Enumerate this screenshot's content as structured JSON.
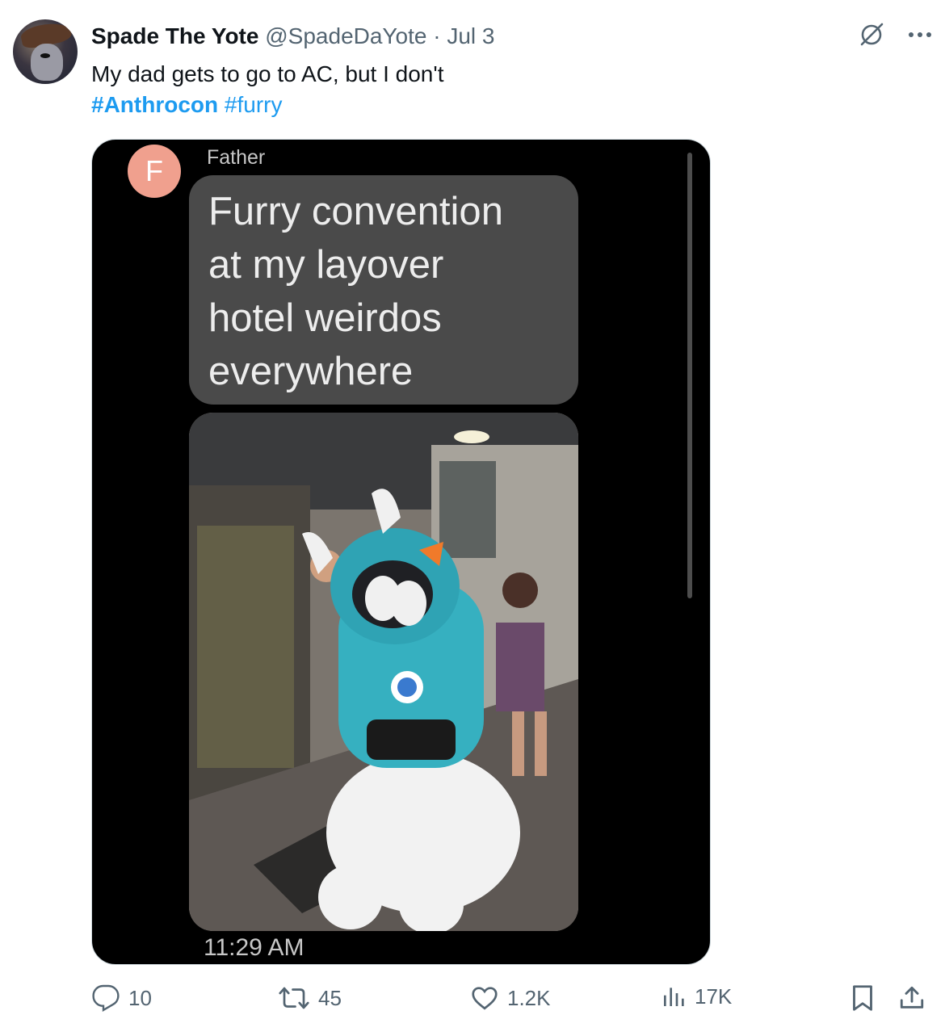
{
  "author": {
    "name": "Spade The Yote",
    "handle": "@SpadeDaYote",
    "separator": "·",
    "date": "Jul 3"
  },
  "tweet": {
    "text": "My dad gets to go to AC, but I don't",
    "hashtags": [
      "#Anthrocon",
      "#furry"
    ]
  },
  "screenshot": {
    "avatar_letter": "F",
    "sender": "Father",
    "message": "Furry convention\nat my layover\nhotel weirdos\neverywhere",
    "time": "11:29 AM",
    "photo_description_icon": "photo-fursuit"
  },
  "actions": {
    "replies": "10",
    "reposts": "45",
    "likes": "1.2K",
    "views": "17K"
  },
  "colors": {
    "accent": "#1d9bf0",
    "muted": "#536471",
    "bubble": "#4a4a4a",
    "avatar_f": "#f0a08e"
  }
}
